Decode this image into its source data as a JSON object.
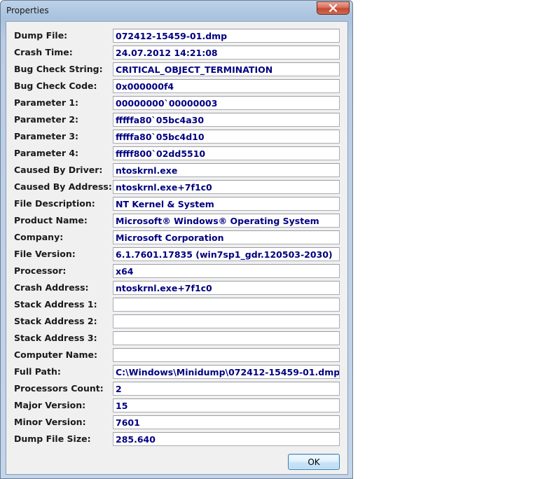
{
  "window": {
    "title": "Properties",
    "close_label": "✕"
  },
  "fields": [
    {
      "label": "Dump File:",
      "value": "072412-15459-01.dmp"
    },
    {
      "label": "Crash Time:",
      "value": "24.07.2012 14:21:08"
    },
    {
      "label": "Bug Check String:",
      "value": "CRITICAL_OBJECT_TERMINATION"
    },
    {
      "label": "Bug Check Code:",
      "value": "0x000000f4"
    },
    {
      "label": "Parameter 1:",
      "value": "00000000`00000003"
    },
    {
      "label": "Parameter 2:",
      "value": "fffffa80`05bc4a30"
    },
    {
      "label": "Parameter 3:",
      "value": "fffffa80`05bc4d10"
    },
    {
      "label": "Parameter 4:",
      "value": "fffff800`02dd5510"
    },
    {
      "label": "Caused By Driver:",
      "value": "ntoskrnl.exe"
    },
    {
      "label": "Caused By Address:",
      "value": "ntoskrnl.exe+7f1c0"
    },
    {
      "label": "File Description:",
      "value": "NT Kernel & System"
    },
    {
      "label": "Product Name:",
      "value": "Microsoft® Windows® Operating System"
    },
    {
      "label": "Company:",
      "value": "Microsoft Corporation"
    },
    {
      "label": "File Version:",
      "value": "6.1.7601.17835 (win7sp1_gdr.120503-2030)"
    },
    {
      "label": "Processor:",
      "value": "x64"
    },
    {
      "label": "Crash Address:",
      "value": "ntoskrnl.exe+7f1c0"
    },
    {
      "label": "Stack Address 1:",
      "value": ""
    },
    {
      "label": "Stack Address 2:",
      "value": ""
    },
    {
      "label": "Stack Address 3:",
      "value": ""
    },
    {
      "label": "Computer Name:",
      "value": ""
    },
    {
      "label": "Full Path:",
      "value": "C:\\Windows\\Minidump\\072412-15459-01.dmp"
    },
    {
      "label": "Processors Count:",
      "value": "2"
    },
    {
      "label": "Major Version:",
      "value": "15"
    },
    {
      "label": "Minor Version:",
      "value": "7601"
    },
    {
      "label": "Dump File Size:",
      "value": "285.640"
    }
  ],
  "buttons": {
    "ok_label": "OK"
  },
  "colors": {
    "value_text": "#000080",
    "close_button": "#c24a33"
  }
}
